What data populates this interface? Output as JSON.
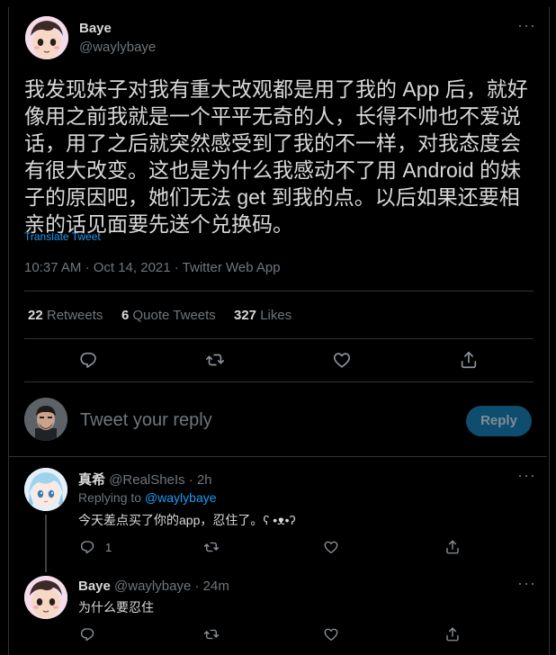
{
  "main_tweet": {
    "author_name": "Baye",
    "author_handle": "@waylybaye",
    "text": "我发现妹子对我有重大改观都是用了我的 App 后，就好像用之前我就是一个平平无奇的人，长得不帅也不爱说话，用了之后就突然感受到了我的不一样，对我态度会有很大改变。这也是为什么我感动不了用 Android 的妹子的原因吧，她们无法 get 到我的点。以后如果还要相亲的话见面要先送个兑换码。",
    "translate_label": "Translate Tweet",
    "meta": "10:37 AM · Oct 14, 2021 · Twitter Web App",
    "stats": {
      "retweets_count": "22",
      "retweets_label": "Retweets",
      "quotes_count": "6",
      "quotes_label": "Quote Tweets",
      "likes_count": "327",
      "likes_label": "Likes"
    }
  },
  "compose": {
    "placeholder": "Tweet your reply",
    "reply_button": "Reply"
  },
  "replies": [
    {
      "author_name": "真希",
      "author_handle": "@RealSheIs",
      "time": "· 2h",
      "replying_prefix": "Replying to",
      "replying_to": "@waylybaye",
      "text": "今天差点买了你的app，忍住了。ʕ •ᴥ•ʔ",
      "reply_count": "1"
    },
    {
      "author_name": "Baye",
      "author_handle": "@waylybaye",
      "time": "· 24m",
      "text": "为什么要忍住"
    }
  ],
  "icons": {
    "more": "more-dots-icon",
    "reply": "reply-bubble-icon",
    "retweet": "retweet-icon",
    "like": "heart-icon",
    "share": "share-icon"
  },
  "colors": {
    "background": "#000000",
    "accent": "#1d9bf0",
    "reply_button_bg": "#0e4d6e",
    "text_primary": "#d9d9d9",
    "text_secondary": "#6e767d",
    "border": "#2f3336"
  }
}
